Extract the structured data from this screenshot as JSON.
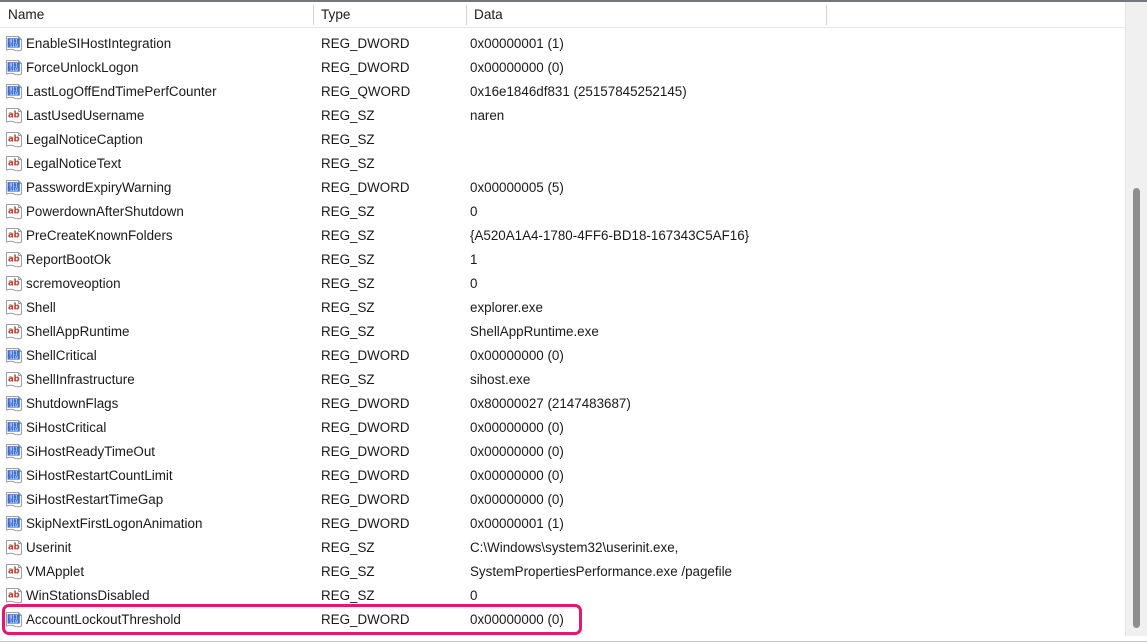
{
  "window": {
    "name": "registry-editor-value-list"
  },
  "columns": {
    "headers": [
      {
        "label": "Name",
        "key": "name"
      },
      {
        "label": "Type",
        "key": "type"
      },
      {
        "label": "Data",
        "key": "data"
      }
    ],
    "divider_positions": [
      313,
      466,
      826
    ]
  },
  "icons": {
    "dword": {
      "semantic": "registry-dword-icon",
      "glyph_top": "011",
      "glyph_bottom": "110",
      "color": "#1a4fb4"
    },
    "string": {
      "semantic": "registry-string-icon",
      "glyph": "ab",
      "color": "#c0392b"
    }
  },
  "highlight": {
    "color": "#e5176f",
    "target_row_index": 24,
    "target_name": "AccountLockoutThreshold"
  },
  "scrollbar": {
    "orientation": "vertical",
    "thumb_color": "#8e8e8e",
    "track_color": "#f0f0f0"
  },
  "rows": [
    {
      "icon": "dword",
      "name": "EnableSIHostIntegration",
      "type": "REG_DWORD",
      "data": "0x00000001 (1)"
    },
    {
      "icon": "dword",
      "name": "ForceUnlockLogon",
      "type": "REG_DWORD",
      "data": "0x00000000 (0)"
    },
    {
      "icon": "dword",
      "name": "LastLogOffEndTimePerfCounter",
      "type": "REG_QWORD",
      "data": "0x16e1846df831 (25157845252145)"
    },
    {
      "icon": "string",
      "name": "LastUsedUsername",
      "type": "REG_SZ",
      "data": "naren"
    },
    {
      "icon": "string",
      "name": "LegalNoticeCaption",
      "type": "REG_SZ",
      "data": ""
    },
    {
      "icon": "string",
      "name": "LegalNoticeText",
      "type": "REG_SZ",
      "data": ""
    },
    {
      "icon": "dword",
      "name": "PasswordExpiryWarning",
      "type": "REG_DWORD",
      "data": "0x00000005 (5)"
    },
    {
      "icon": "string",
      "name": "PowerdownAfterShutdown",
      "type": "REG_SZ",
      "data": "0"
    },
    {
      "icon": "string",
      "name": "PreCreateKnownFolders",
      "type": "REG_SZ",
      "data": "{A520A1A4-1780-4FF6-BD18-167343C5AF16}"
    },
    {
      "icon": "string",
      "name": "ReportBootOk",
      "type": "REG_SZ",
      "data": "1"
    },
    {
      "icon": "string",
      "name": "scremoveoption",
      "type": "REG_SZ",
      "data": "0"
    },
    {
      "icon": "string",
      "name": "Shell",
      "type": "REG_SZ",
      "data": "explorer.exe"
    },
    {
      "icon": "string",
      "name": "ShellAppRuntime",
      "type": "REG_SZ",
      "data": "ShellAppRuntime.exe"
    },
    {
      "icon": "dword",
      "name": "ShellCritical",
      "type": "REG_DWORD",
      "data": "0x00000000 (0)"
    },
    {
      "icon": "string",
      "name": "ShellInfrastructure",
      "type": "REG_SZ",
      "data": "sihost.exe"
    },
    {
      "icon": "dword",
      "name": "ShutdownFlags",
      "type": "REG_DWORD",
      "data": "0x80000027 (2147483687)"
    },
    {
      "icon": "dword",
      "name": "SiHostCritical",
      "type": "REG_DWORD",
      "data": "0x00000000 (0)"
    },
    {
      "icon": "dword",
      "name": "SiHostReadyTimeOut",
      "type": "REG_DWORD",
      "data": "0x00000000 (0)"
    },
    {
      "icon": "dword",
      "name": "SiHostRestartCountLimit",
      "type": "REG_DWORD",
      "data": "0x00000000 (0)"
    },
    {
      "icon": "dword",
      "name": "SiHostRestartTimeGap",
      "type": "REG_DWORD",
      "data": "0x00000000 (0)"
    },
    {
      "icon": "dword",
      "name": "SkipNextFirstLogonAnimation",
      "type": "REG_DWORD",
      "data": "0x00000001 (1)"
    },
    {
      "icon": "string",
      "name": "Userinit",
      "type": "REG_SZ",
      "data": "C:\\Windows\\system32\\userinit.exe,"
    },
    {
      "icon": "string",
      "name": "VMApplet",
      "type": "REG_SZ",
      "data": "SystemPropertiesPerformance.exe /pagefile"
    },
    {
      "icon": "string",
      "name": "WinStationsDisabled",
      "type": "REG_SZ",
      "data": "0"
    },
    {
      "icon": "dword",
      "name": "AccountLockoutThreshold",
      "type": "REG_DWORD",
      "data": "0x00000000 (0)"
    }
  ]
}
